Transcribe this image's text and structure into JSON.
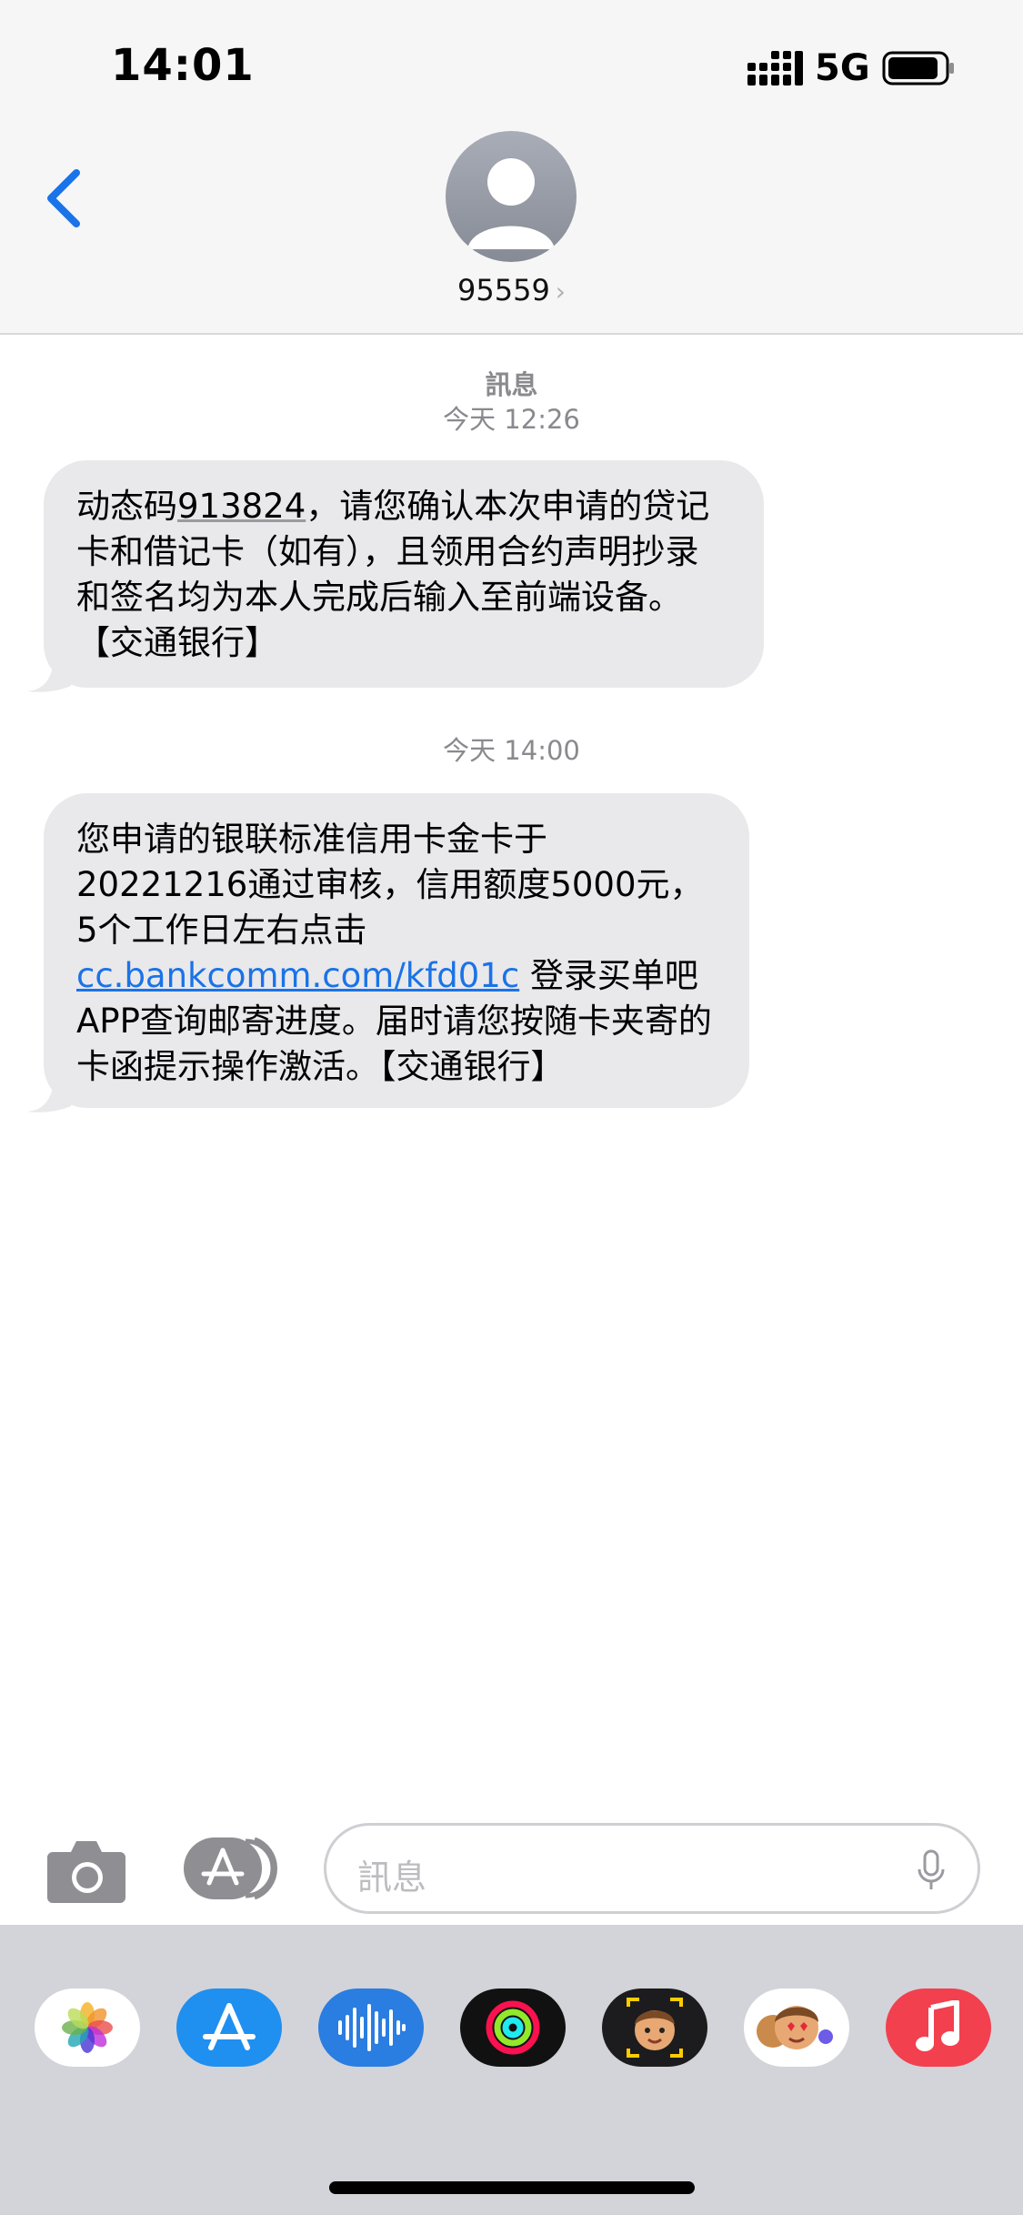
{
  "status_bar": {
    "time": "14:01",
    "network": "5G"
  },
  "header": {
    "contact": "95559"
  },
  "messages": [
    {
      "label": "訊息",
      "timestamp": "今天 12:26",
      "text_before": "动态码",
      "code": "913824",
      "text_after": "，请您确认本次申请的贷记卡和借记卡（如有），且领用合约声明抄录和签名均为本人完成后输入至前端设备。【交通银行】"
    },
    {
      "timestamp": "今天 14:00",
      "text_before": "您申请的银联标准信用卡金卡于20221216通过审核，信用额度5000元，5个工作日左右点击",
      "link": "cc.bankcomm.com/kfd01c",
      "text_after": "登录买单吧APP查询邮寄进度。届时请您按随卡夹寄的卡函提示操作激活。【交通银行】"
    }
  ],
  "input_bar": {
    "placeholder": "訊息"
  },
  "app_strip": [
    "photos-app",
    "app-store-app",
    "audio-messages-app",
    "activity-app",
    "memoji-app",
    "animoji-stickers-app",
    "music-app"
  ],
  "colors": {
    "link": "#1a73e8",
    "bubble": "#e9e9eb",
    "back": "#1a73e8"
  }
}
